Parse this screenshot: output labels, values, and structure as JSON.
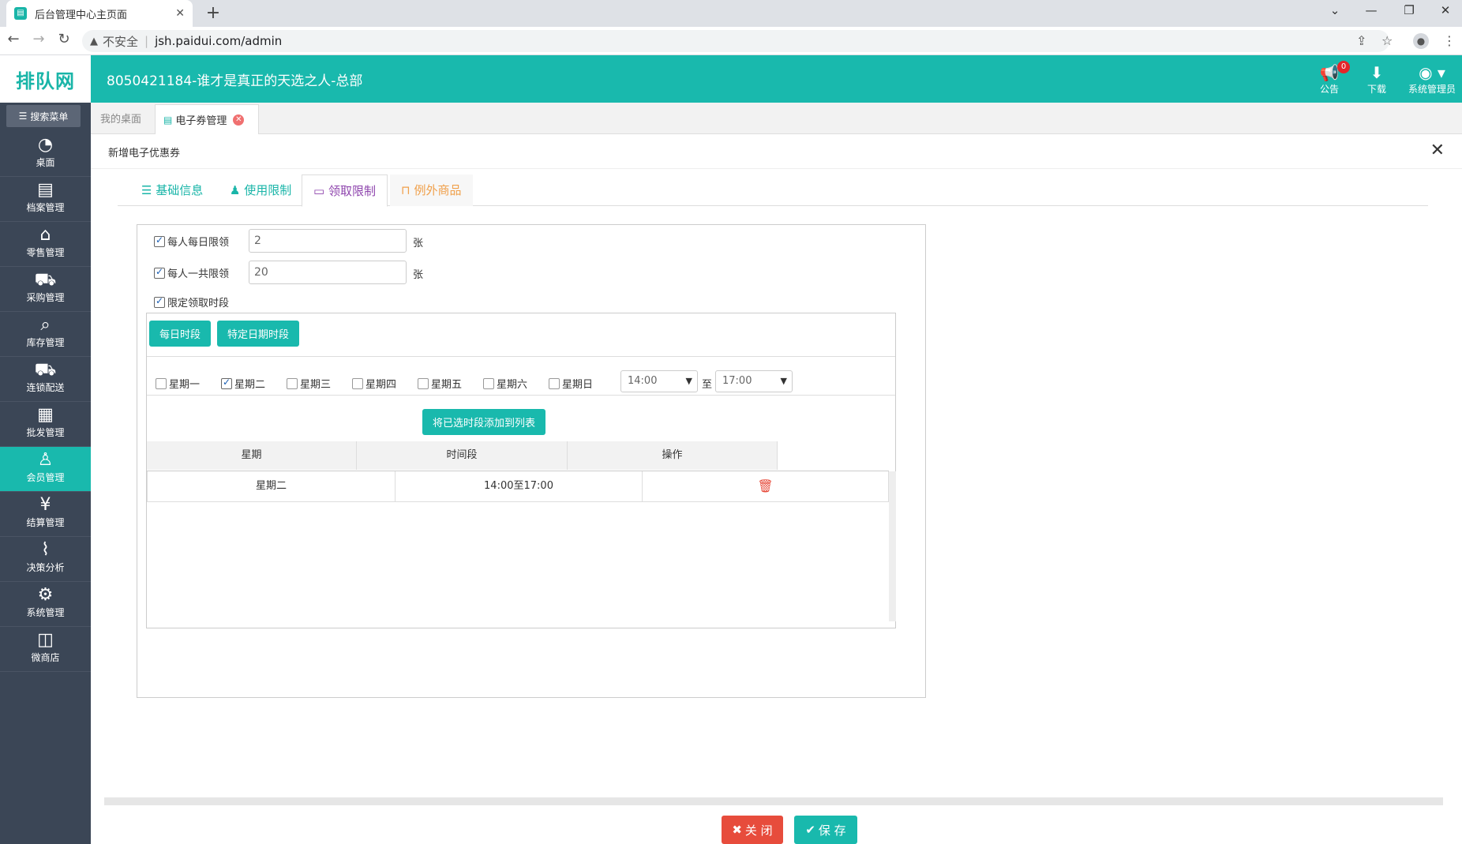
{
  "browser": {
    "tab_title": "后台管理中心主页面",
    "tab_icon": "page-icon",
    "new_tab": "+",
    "security_label": "不安全",
    "url": "jsh.paidui.com/admin"
  },
  "header": {
    "logo_text": "排队网",
    "company": "8050421184-谁才是真正的天选之人-总部",
    "notice_label": "公告",
    "notice_badge": "0",
    "download_label": "下载",
    "user_label": "系统管理员",
    "bg_color": "#19b9ad"
  },
  "sidebar": {
    "search_label": "搜索菜单",
    "items": [
      {
        "label": "桌面",
        "icon": "dashboard-icon"
      },
      {
        "label": "档案管理",
        "icon": "archive-icon"
      },
      {
        "label": "零售管理",
        "icon": "store-icon"
      },
      {
        "label": "采购管理",
        "icon": "cart-icon"
      },
      {
        "label": "库存管理",
        "icon": "inventory-icon"
      },
      {
        "label": "连锁配送",
        "icon": "delivery-icon"
      },
      {
        "label": "批发管理",
        "icon": "wholesale-icon"
      },
      {
        "label": "会员管理",
        "icon": "member-icon"
      },
      {
        "label": "结算管理",
        "icon": "settlement-icon"
      },
      {
        "label": "决策分析",
        "icon": "analysis-icon"
      },
      {
        "label": "系统管理",
        "icon": "gear-icon"
      },
      {
        "label": "微商店",
        "icon": "shop-bag-icon"
      }
    ]
  },
  "page_tabs": {
    "desktop": "我的桌面",
    "current": "电子券管理"
  },
  "dialog": {
    "title": "新增电子优惠券",
    "tabs": [
      "基础信息",
      "使用限制",
      "领取限制",
      "例外商品"
    ],
    "active_tab": "领取限制"
  },
  "limits": {
    "daily_label": "每人每日限领",
    "daily_value": "2",
    "total_label": "每人一共限领",
    "total_value": "20",
    "unit": "张",
    "period_label": "限定领取时段"
  },
  "period": {
    "daily_button": "每日时段",
    "special_button": "特定日期时段",
    "weekdays": [
      {
        "label": "星期一",
        "checked": false
      },
      {
        "label": "星期二",
        "checked": true
      },
      {
        "label": "星期三",
        "checked": false
      },
      {
        "label": "星期四",
        "checked": false
      },
      {
        "label": "星期五",
        "checked": false
      },
      {
        "label": "星期六",
        "checked": false
      },
      {
        "label": "星期日",
        "checked": false
      }
    ],
    "start_time": "14:00",
    "to_label": "至",
    "end_time": "17:00",
    "add_button": "将已选时段添加到列表"
  },
  "table": {
    "headers": [
      "星期",
      "时间段",
      "操作"
    ],
    "rows": [
      {
        "day": "星期二",
        "time": "14:00至17:00"
      }
    ]
  },
  "footer": {
    "close_label": "关 闭",
    "save_label": "保 存"
  }
}
